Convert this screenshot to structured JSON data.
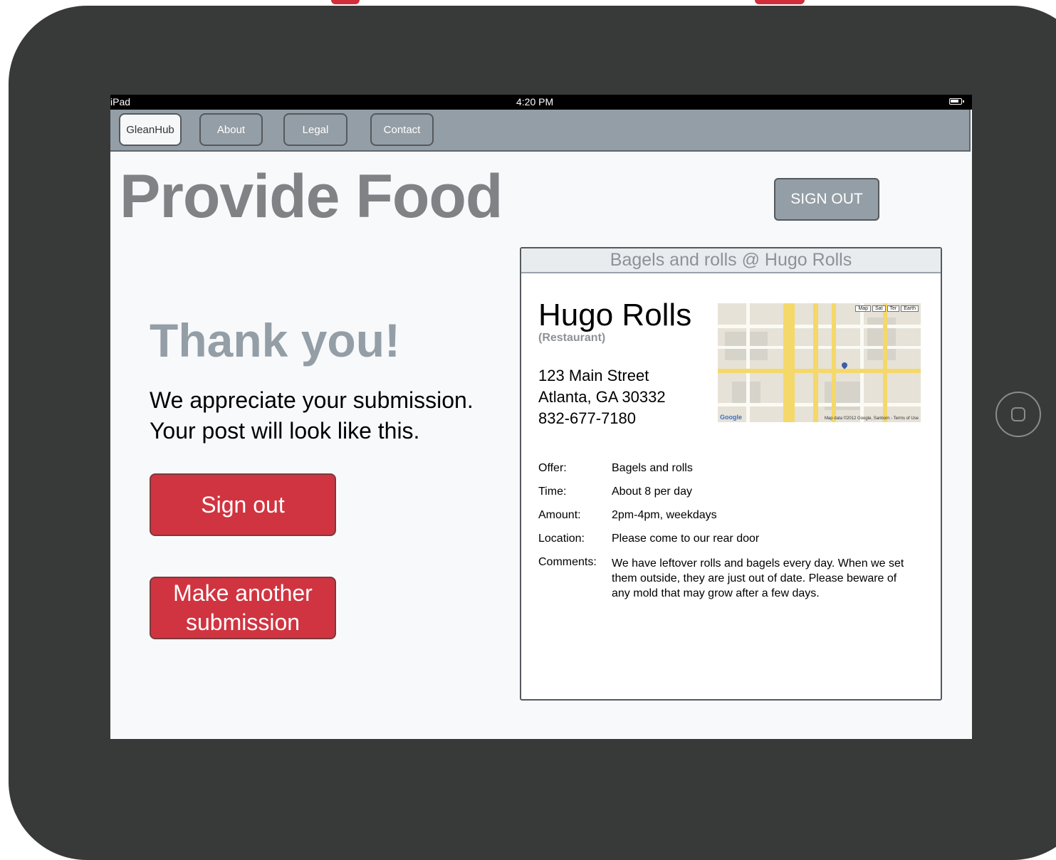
{
  "device": {
    "home_button_icon": "home-button-icon"
  },
  "statusbar": {
    "carrier": "iPad",
    "time": "4:20 PM",
    "battery_icon": "battery-icon"
  },
  "nav": {
    "items": [
      "GleanHub",
      "About",
      "Legal",
      "Contact"
    ],
    "active": "GleanHub"
  },
  "header": {
    "title": "Provide Food",
    "signout_label": "SIGN OUT"
  },
  "confirmation": {
    "heading": "Thank you!",
    "message_line1": "We appreciate your submission.",
    "message_line2": "Your post will look like this.",
    "signout_button": "Sign out",
    "another_button_line1": "Make another",
    "another_button_line2": "submission"
  },
  "post": {
    "header": "Bagels and rolls @ Hugo Rolls",
    "name": "Hugo Rolls",
    "type": "(Restaurant)",
    "address_line1": "123 Main Street",
    "address_line2": "Atlanta, GA 30332",
    "phone": "832-677-7180",
    "map": {
      "types": [
        "Map",
        "Sat",
        "Ter",
        "Earth"
      ],
      "logo": "Google",
      "credit": "Map data ©2012 Google, Sanborn - Terms of Use"
    },
    "details": [
      {
        "label": "Offer:",
        "value": "Bagels and rolls"
      },
      {
        "label": "Time:",
        "value": "About 8 per day"
      },
      {
        "label": "Amount:",
        "value": "2pm-4pm, weekdays"
      },
      {
        "label": "Location:",
        "value": "Please come to our rear door"
      },
      {
        "label": "Comments:",
        "value": "We have leftover rolls and bagels every day. When we set them outside, they are just out of date. Please beware of any mold that may grow after a few days."
      }
    ]
  },
  "colors": {
    "accent_red": "#d03440",
    "nav_gray": "#949ea6",
    "device_frame": "#383a39"
  }
}
